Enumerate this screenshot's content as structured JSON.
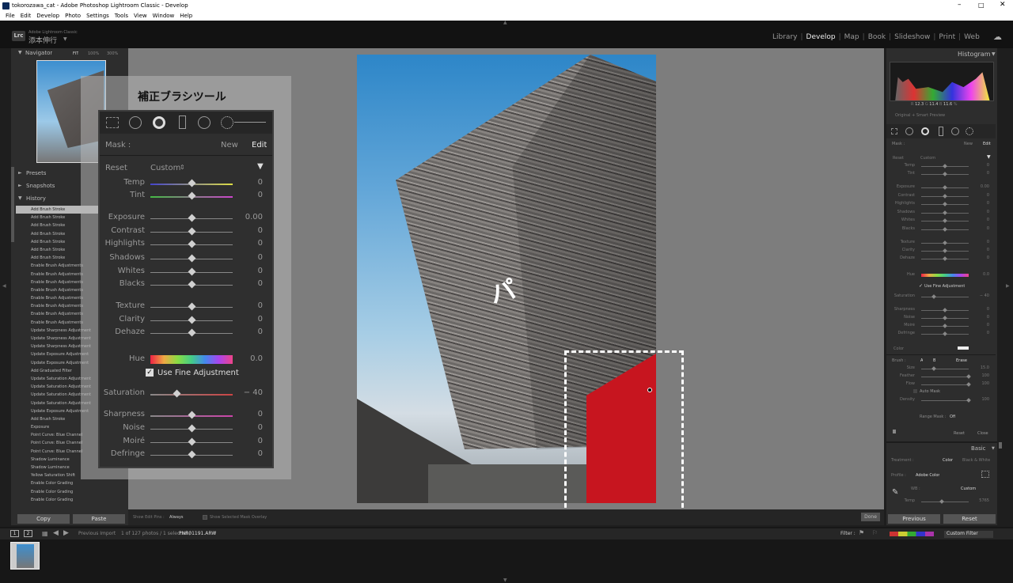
{
  "window": {
    "title": "tokorozawa_cat - Adobe Photoshop Lightroom Classic - Develop"
  },
  "menu": [
    "File",
    "Edit",
    "Develop",
    "Photo",
    "Settings",
    "Tools",
    "View",
    "Window",
    "Help"
  ],
  "identity": {
    "logo": "Lrc",
    "app_name": "Adobe Lightroom Classic",
    "user": "添本伸行"
  },
  "modules": [
    "Library",
    "Develop",
    "Map",
    "Book",
    "Slideshow",
    "Print",
    "Web"
  ],
  "active_module": "Develop",
  "navigator": {
    "title": "Navigator",
    "zoom": [
      "FIT",
      "100%",
      "300%"
    ]
  },
  "left_panels": {
    "presets": "Presets",
    "snapshots": "Snapshots",
    "history": "History"
  },
  "history": [
    "Add Brush Stroke",
    "Add Brush Stroke",
    "Add Brush Stroke",
    "Add Brush Stroke",
    "Add Brush Stroke",
    "Add Brush Stroke",
    "Add Brush Stroke",
    "Enable Brush Adjustments",
    "Enable Brush Adjustments",
    "Enable Brush Adjustments",
    "Enable Brush Adjustments",
    "Enable Brush Adjustments",
    "Enable Brush Adjustments",
    "Enable Brush Adjustments",
    "Enable Brush Adjustments",
    "Update Sharpness Adjustment",
    "Update Sharpness Adjustment",
    "Update Sharpness Adjustment",
    "Update Exposure Adjustment",
    "Update Exposure Adjustment",
    "Add Graduated Filter",
    "Update Saturation Adjustment",
    "Update Saturation Adjustment",
    "Update Saturation Adjustment",
    "Update Saturation Adjustment",
    "Update Exposure Adjustment",
    "Add Brush Stroke",
    "Exposure",
    "Point Curve: Blue Channel",
    "Point Curve: Blue Channel",
    "Point Curve: Blue Channel",
    "Shadow Luminance",
    "Shadow Luminance",
    "Yellow Saturation Shift",
    "Enable Color Grading",
    "Enable Color Grading",
    "Enable Color Grading"
  ],
  "left_buttons": {
    "copy": "Copy",
    "paste": "Paste"
  },
  "zoom_panel": {
    "title": "補正ブラシツール",
    "mask_label": "Mask :",
    "new": "New",
    "edit": "Edit",
    "reset": "Reset",
    "preset": "Custom",
    "temp": {
      "label": "Temp",
      "value": "0"
    },
    "tint": {
      "label": "Tint",
      "value": "0"
    },
    "exposure": {
      "label": "Exposure",
      "value": "0.00"
    },
    "contrast": {
      "label": "Contrast",
      "value": "0"
    },
    "highlights": {
      "label": "Highlights",
      "value": "0"
    },
    "shadows": {
      "label": "Shadows",
      "value": "0"
    },
    "whites": {
      "label": "Whites",
      "value": "0"
    },
    "blacks": {
      "label": "Blacks",
      "value": "0"
    },
    "texture": {
      "label": "Texture",
      "value": "0"
    },
    "clarity": {
      "label": "Clarity",
      "value": "0"
    },
    "dehaze": {
      "label": "Dehaze",
      "value": "0"
    },
    "hue": {
      "label": "Hue",
      "value": "0.0"
    },
    "fine": "Use Fine Adjustment",
    "saturation": {
      "label": "Saturation",
      "value": "− 40"
    },
    "sharpness": {
      "label": "Sharpness",
      "value": "0"
    },
    "noise": {
      "label": "Noise",
      "value": "0"
    },
    "moire": {
      "label": "Moiré",
      "value": "0"
    },
    "defringe": {
      "label": "Defringe",
      "value": "0"
    }
  },
  "photo_overlay_text": "パ",
  "histogram": {
    "title": "Histogram",
    "r_label": "R",
    "r": "12.3",
    "g_label": "G",
    "g": "11.4",
    "b_label": "B",
    "b": "11.6",
    "pct": "%",
    "preview": "Original + Smart Preview"
  },
  "right_panel": {
    "mask": "Mask :",
    "new": "New",
    "edit": "Edit",
    "reset": "Reset",
    "preset": "Custom",
    "rows": [
      {
        "label": "Temp",
        "value": "0"
      },
      {
        "label": "Tint",
        "value": "0"
      },
      {
        "label": "Exposure",
        "value": "0.00"
      },
      {
        "label": "Contrast",
        "value": "0"
      },
      {
        "label": "Highlights",
        "value": "0"
      },
      {
        "label": "Shadows",
        "value": "0"
      },
      {
        "label": "Whites",
        "value": "0"
      },
      {
        "label": "Blacks",
        "value": "0"
      },
      {
        "label": "Texture",
        "value": "0"
      },
      {
        "label": "Clarity",
        "value": "0"
      },
      {
        "label": "Dehaze",
        "value": "0"
      },
      {
        "label": "Hue",
        "value": "0.0"
      },
      {
        "label": "Saturation",
        "value": "− 40"
      },
      {
        "label": "Sharpness",
        "value": "0"
      },
      {
        "label": "Noise",
        "value": "0"
      },
      {
        "label": "Moiré",
        "value": "0"
      },
      {
        "label": "Defringe",
        "value": "0"
      }
    ],
    "fine": "Use Fine Adjustment",
    "color": "Color",
    "brush": "Brush :",
    "brush_a": "A",
    "brush_b": "B",
    "erase": "Erase",
    "size": {
      "label": "Size",
      "value": "15.0"
    },
    "feather": {
      "label": "Feather",
      "value": "100"
    },
    "flow": {
      "label": "Flow",
      "value": "100"
    },
    "automask": "Auto Mask",
    "density": {
      "label": "Density",
      "value": "100"
    },
    "range_mask": "Range Mask :",
    "range_value": "Off",
    "reset_btn": "Reset",
    "close_btn": "Close",
    "basic": "Basic",
    "treatment": "Treatment :",
    "color_tab": "Color",
    "bw_tab": "Black & White",
    "profile": "Profile :",
    "profile_value": "Adobe Color",
    "wb": "WB :",
    "wb_value": "Custom",
    "temp_label": "Temp",
    "temp_value": "5765"
  },
  "right_buttons": {
    "previous": "Previous",
    "reset": "Reset"
  },
  "toolbar": {
    "show_edit_pins": "Show Edit Pins :",
    "pins_value": "Always",
    "show_overlay": "Show Selected Mask Overlay",
    "done": "Done"
  },
  "filmstrip": {
    "page1": "1",
    "page2": "2",
    "source": "Previous Import",
    "count": "1 of 127 photos / 1 selected /",
    "filename": "PNR01191.ARW",
    "filter": "Filter :",
    "custom_filter": "Custom Filter"
  },
  "colors": {
    "accent_red": "#d8141e",
    "sky": "#3c8fce",
    "panel": "#2d2d2d"
  }
}
